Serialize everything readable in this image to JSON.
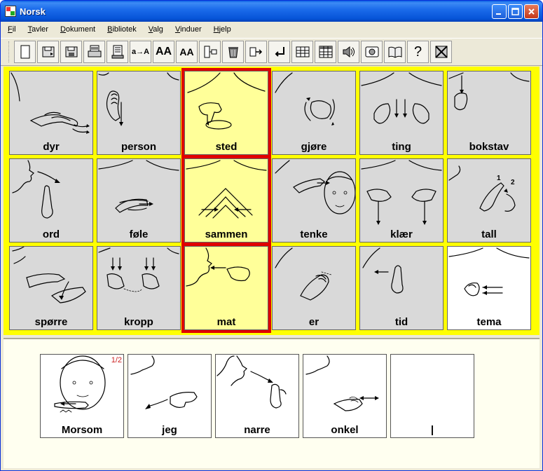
{
  "window": {
    "title": "Norsk"
  },
  "menu": [
    "Fil",
    "Tavler",
    "Dokument",
    "Bibliotek",
    "Valg",
    "Vinduer",
    "Hjelp"
  ],
  "toolbar": [
    {
      "icon": "new-document-icon"
    },
    {
      "icon": "save-to-disk-icon"
    },
    {
      "icon": "save-as-icon"
    },
    {
      "icon": "print-icon"
    },
    {
      "icon": "print-preview-icon"
    },
    {
      "icon": "text-case-icon",
      "text": "a→A"
    },
    {
      "icon": "font-larger-icon",
      "text": "AA"
    },
    {
      "icon": "font-smaller-icon",
      "text": "AA"
    },
    {
      "icon": "insert-symbol-icon"
    },
    {
      "icon": "trash-icon"
    },
    {
      "icon": "arrow-right-icon"
    },
    {
      "icon": "enter-return-icon"
    },
    {
      "icon": "grid-icon"
    },
    {
      "icon": "table-grid-icon"
    },
    {
      "icon": "speaker-icon"
    },
    {
      "icon": "image-icon"
    },
    {
      "icon": "book-icon"
    },
    {
      "icon": "help-icon",
      "text": "?"
    },
    {
      "icon": "close-board-icon"
    }
  ],
  "board": {
    "background": "#FFFF00",
    "rows": [
      [
        {
          "label": "dyr",
          "highlight": false
        },
        {
          "label": "person",
          "highlight": false
        },
        {
          "label": "sted",
          "highlight": true
        },
        {
          "label": "gjøre",
          "highlight": false
        },
        {
          "label": "ting",
          "highlight": false
        },
        {
          "label": "bokstav",
          "highlight": false
        }
      ],
      [
        {
          "label": "ord",
          "highlight": false
        },
        {
          "label": "føle",
          "highlight": false
        },
        {
          "label": "sammen",
          "highlight": true
        },
        {
          "label": "tenke",
          "highlight": false
        },
        {
          "label": "klær",
          "highlight": false
        },
        {
          "label": "tall",
          "highlight": false
        }
      ],
      [
        {
          "label": "spørre",
          "highlight": false
        },
        {
          "label": "kropp",
          "highlight": false
        },
        {
          "label": "mat",
          "highlight": true
        },
        {
          "label": "er",
          "highlight": false
        },
        {
          "label": "tid",
          "highlight": false
        },
        {
          "label": "tema",
          "highlight": false,
          "white": true
        }
      ]
    ]
  },
  "sentence": {
    "page_indicator": "1/2",
    "items": [
      {
        "label": "Morsom"
      },
      {
        "label": "jeg"
      },
      {
        "label": "narre"
      },
      {
        "label": "onkel"
      },
      {
        "label": "|"
      }
    ]
  },
  "colors": {
    "highlight_border": "#E00000",
    "highlight_fill": "#FFFF99",
    "cell_fill": "#D9D9D9",
    "titlebar": "#0654D8"
  }
}
